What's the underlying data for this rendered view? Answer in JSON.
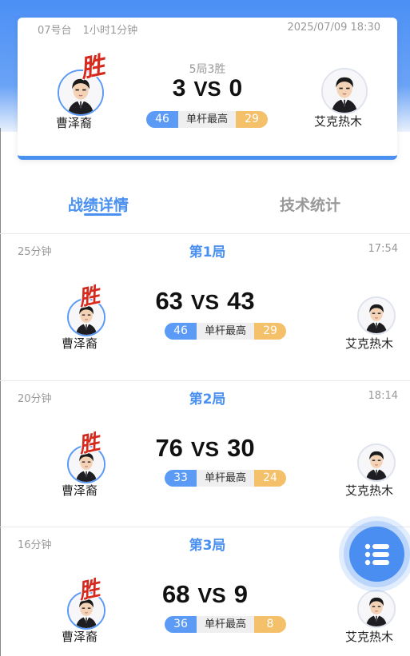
{
  "match": {
    "table": "07号台",
    "duration": "1小时1分钟",
    "datetime": "2025/07/09 18:30",
    "format": "5局3胜",
    "player1": {
      "name": "曹泽裔",
      "score": "3",
      "high_break": "46",
      "winner": true
    },
    "player2": {
      "name": "艾克热木",
      "score": "0",
      "high_break": "29",
      "winner": false
    },
    "vs": "VS",
    "high_break_label": "单杆最高",
    "win_badge": "胜"
  },
  "tabs": [
    {
      "label": "战绩详情",
      "active": true
    },
    {
      "label": "技术统计",
      "active": false
    }
  ],
  "frames": [
    {
      "title": "第1局",
      "duration": "25分钟",
      "time": "17:54",
      "p1_score": "63",
      "p2_score": "43",
      "p1_high": "46",
      "p2_high": "29",
      "p1_name": "曹泽裔",
      "p2_name": "艾克热木"
    },
    {
      "title": "第2局",
      "duration": "20分钟",
      "time": "18:14",
      "p1_score": "76",
      "p2_score": "30",
      "p1_high": "33",
      "p2_high": "24",
      "p1_name": "曹泽裔",
      "p2_name": "艾克热木"
    },
    {
      "title": "第3局",
      "duration": "16分钟",
      "time": "",
      "p1_score": "68",
      "p2_score": "9",
      "p1_high": "36",
      "p2_high": "8",
      "p1_name": "曹泽裔",
      "p2_name": "艾克热木"
    }
  ],
  "fab": {
    "icon": "list-icon"
  },
  "colors": {
    "accent": "#4a90f0",
    "opponent": "#f4c06a",
    "win": "#d62a1e"
  }
}
